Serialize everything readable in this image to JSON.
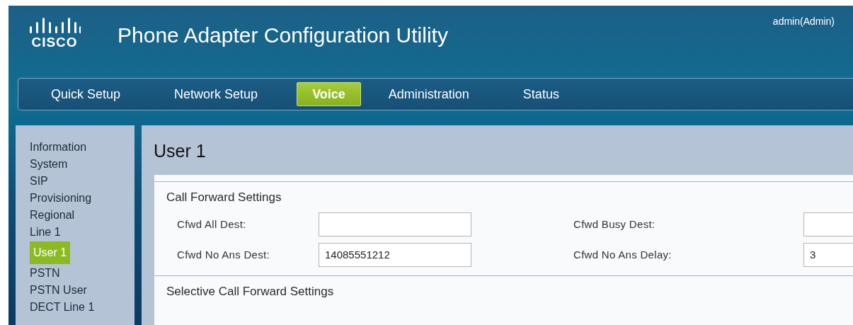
{
  "header": {
    "logo": "CISCO",
    "title": "Phone Adapter Configuration Utility",
    "user": "admin(Admin)"
  },
  "tabs": [
    {
      "label": "Quick Setup",
      "selected": false
    },
    {
      "label": "Network Setup",
      "selected": false
    },
    {
      "label": "Voice",
      "selected": true
    },
    {
      "label": "Administration",
      "selected": false
    },
    {
      "label": "Status",
      "selected": false
    }
  ],
  "sidebar": {
    "items": [
      {
        "label": "Information",
        "selected": false
      },
      {
        "label": "System",
        "selected": false
      },
      {
        "label": "SIP",
        "selected": false
      },
      {
        "label": "Provisioning",
        "selected": false
      },
      {
        "label": "Regional",
        "selected": false
      },
      {
        "label": "Line 1",
        "selected": false
      },
      {
        "label": "User 1",
        "selected": true
      },
      {
        "label": "PSTN",
        "selected": false
      },
      {
        "label": "PSTN User",
        "selected": false
      },
      {
        "label": "DECT Line 1",
        "selected": false
      }
    ]
  },
  "page_title": "User 1",
  "sections": [
    {
      "title": "Call Forward Settings",
      "rows": [
        [
          {
            "label": "Cfwd All Dest:"
          },
          {
            "label": "Cfwd Busy Dest:"
          }
        ],
        [
          {
            "label": "Cfwd No Ans Dest:",
            "value": "14085551212"
          },
          {
            "label": "Cfwd No Ans Delay:",
            "value": "3"
          }
        ]
      ]
    },
    {
      "title": "Selective Call Forward Settings"
    }
  ]
}
